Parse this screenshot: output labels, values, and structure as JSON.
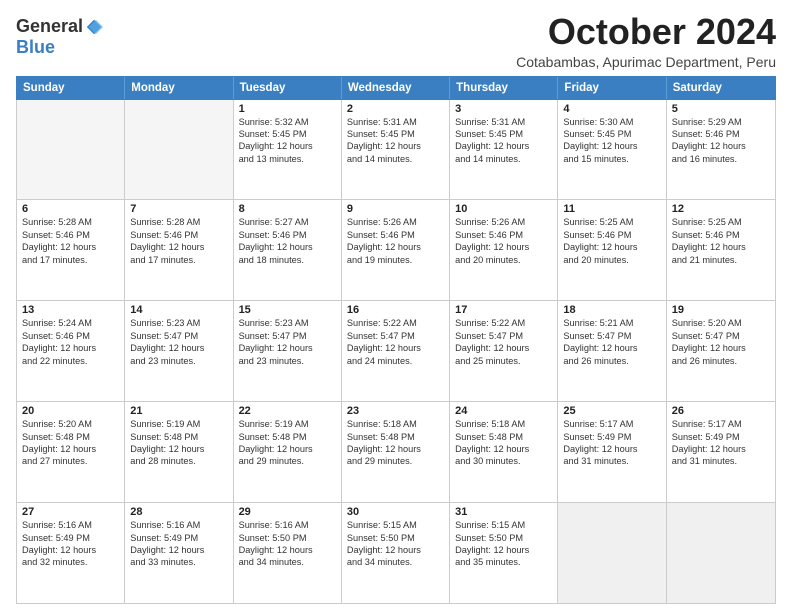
{
  "logo": {
    "general": "General",
    "blue": "Blue"
  },
  "title": "October 2024",
  "subtitle": "Cotabambas, Apurimac Department, Peru",
  "header_days": [
    "Sunday",
    "Monday",
    "Tuesday",
    "Wednesday",
    "Thursday",
    "Friday",
    "Saturday"
  ],
  "weeks": [
    [
      {
        "day": "",
        "lines": [],
        "empty": true
      },
      {
        "day": "",
        "lines": [],
        "empty": true
      },
      {
        "day": "1",
        "lines": [
          "Sunrise: 5:32 AM",
          "Sunset: 5:45 PM",
          "Daylight: 12 hours",
          "and 13 minutes."
        ]
      },
      {
        "day": "2",
        "lines": [
          "Sunrise: 5:31 AM",
          "Sunset: 5:45 PM",
          "Daylight: 12 hours",
          "and 14 minutes."
        ]
      },
      {
        "day": "3",
        "lines": [
          "Sunrise: 5:31 AM",
          "Sunset: 5:45 PM",
          "Daylight: 12 hours",
          "and 14 minutes."
        ]
      },
      {
        "day": "4",
        "lines": [
          "Sunrise: 5:30 AM",
          "Sunset: 5:45 PM",
          "Daylight: 12 hours",
          "and 15 minutes."
        ]
      },
      {
        "day": "5",
        "lines": [
          "Sunrise: 5:29 AM",
          "Sunset: 5:46 PM",
          "Daylight: 12 hours",
          "and 16 minutes."
        ]
      }
    ],
    [
      {
        "day": "6",
        "lines": [
          "Sunrise: 5:28 AM",
          "Sunset: 5:46 PM",
          "Daylight: 12 hours",
          "and 17 minutes."
        ]
      },
      {
        "day": "7",
        "lines": [
          "Sunrise: 5:28 AM",
          "Sunset: 5:46 PM",
          "Daylight: 12 hours",
          "and 17 minutes."
        ]
      },
      {
        "day": "8",
        "lines": [
          "Sunrise: 5:27 AM",
          "Sunset: 5:46 PM",
          "Daylight: 12 hours",
          "and 18 minutes."
        ]
      },
      {
        "day": "9",
        "lines": [
          "Sunrise: 5:26 AM",
          "Sunset: 5:46 PM",
          "Daylight: 12 hours",
          "and 19 minutes."
        ]
      },
      {
        "day": "10",
        "lines": [
          "Sunrise: 5:26 AM",
          "Sunset: 5:46 PM",
          "Daylight: 12 hours",
          "and 20 minutes."
        ]
      },
      {
        "day": "11",
        "lines": [
          "Sunrise: 5:25 AM",
          "Sunset: 5:46 PM",
          "Daylight: 12 hours",
          "and 20 minutes."
        ]
      },
      {
        "day": "12",
        "lines": [
          "Sunrise: 5:25 AM",
          "Sunset: 5:46 PM",
          "Daylight: 12 hours",
          "and 21 minutes."
        ]
      }
    ],
    [
      {
        "day": "13",
        "lines": [
          "Sunrise: 5:24 AM",
          "Sunset: 5:46 PM",
          "Daylight: 12 hours",
          "and 22 minutes."
        ]
      },
      {
        "day": "14",
        "lines": [
          "Sunrise: 5:23 AM",
          "Sunset: 5:47 PM",
          "Daylight: 12 hours",
          "and 23 minutes."
        ]
      },
      {
        "day": "15",
        "lines": [
          "Sunrise: 5:23 AM",
          "Sunset: 5:47 PM",
          "Daylight: 12 hours",
          "and 23 minutes."
        ]
      },
      {
        "day": "16",
        "lines": [
          "Sunrise: 5:22 AM",
          "Sunset: 5:47 PM",
          "Daylight: 12 hours",
          "and 24 minutes."
        ]
      },
      {
        "day": "17",
        "lines": [
          "Sunrise: 5:22 AM",
          "Sunset: 5:47 PM",
          "Daylight: 12 hours",
          "and 25 minutes."
        ]
      },
      {
        "day": "18",
        "lines": [
          "Sunrise: 5:21 AM",
          "Sunset: 5:47 PM",
          "Daylight: 12 hours",
          "and 26 minutes."
        ]
      },
      {
        "day": "19",
        "lines": [
          "Sunrise: 5:20 AM",
          "Sunset: 5:47 PM",
          "Daylight: 12 hours",
          "and 26 minutes."
        ]
      }
    ],
    [
      {
        "day": "20",
        "lines": [
          "Sunrise: 5:20 AM",
          "Sunset: 5:48 PM",
          "Daylight: 12 hours",
          "and 27 minutes."
        ]
      },
      {
        "day": "21",
        "lines": [
          "Sunrise: 5:19 AM",
          "Sunset: 5:48 PM",
          "Daylight: 12 hours",
          "and 28 minutes."
        ]
      },
      {
        "day": "22",
        "lines": [
          "Sunrise: 5:19 AM",
          "Sunset: 5:48 PM",
          "Daylight: 12 hours",
          "and 29 minutes."
        ]
      },
      {
        "day": "23",
        "lines": [
          "Sunrise: 5:18 AM",
          "Sunset: 5:48 PM",
          "Daylight: 12 hours",
          "and 29 minutes."
        ]
      },
      {
        "day": "24",
        "lines": [
          "Sunrise: 5:18 AM",
          "Sunset: 5:48 PM",
          "Daylight: 12 hours",
          "and 30 minutes."
        ]
      },
      {
        "day": "25",
        "lines": [
          "Sunrise: 5:17 AM",
          "Sunset: 5:49 PM",
          "Daylight: 12 hours",
          "and 31 minutes."
        ]
      },
      {
        "day": "26",
        "lines": [
          "Sunrise: 5:17 AM",
          "Sunset: 5:49 PM",
          "Daylight: 12 hours",
          "and 31 minutes."
        ]
      }
    ],
    [
      {
        "day": "27",
        "lines": [
          "Sunrise: 5:16 AM",
          "Sunset: 5:49 PM",
          "Daylight: 12 hours",
          "and 32 minutes."
        ]
      },
      {
        "day": "28",
        "lines": [
          "Sunrise: 5:16 AM",
          "Sunset: 5:49 PM",
          "Daylight: 12 hours",
          "and 33 minutes."
        ]
      },
      {
        "day": "29",
        "lines": [
          "Sunrise: 5:16 AM",
          "Sunset: 5:50 PM",
          "Daylight: 12 hours",
          "and 34 minutes."
        ]
      },
      {
        "day": "30",
        "lines": [
          "Sunrise: 5:15 AM",
          "Sunset: 5:50 PM",
          "Daylight: 12 hours",
          "and 34 minutes."
        ]
      },
      {
        "day": "31",
        "lines": [
          "Sunrise: 5:15 AM",
          "Sunset: 5:50 PM",
          "Daylight: 12 hours",
          "and 35 minutes."
        ]
      },
      {
        "day": "",
        "lines": [],
        "empty": true,
        "shaded": true
      },
      {
        "day": "",
        "lines": [],
        "empty": true,
        "shaded": true
      }
    ]
  ]
}
